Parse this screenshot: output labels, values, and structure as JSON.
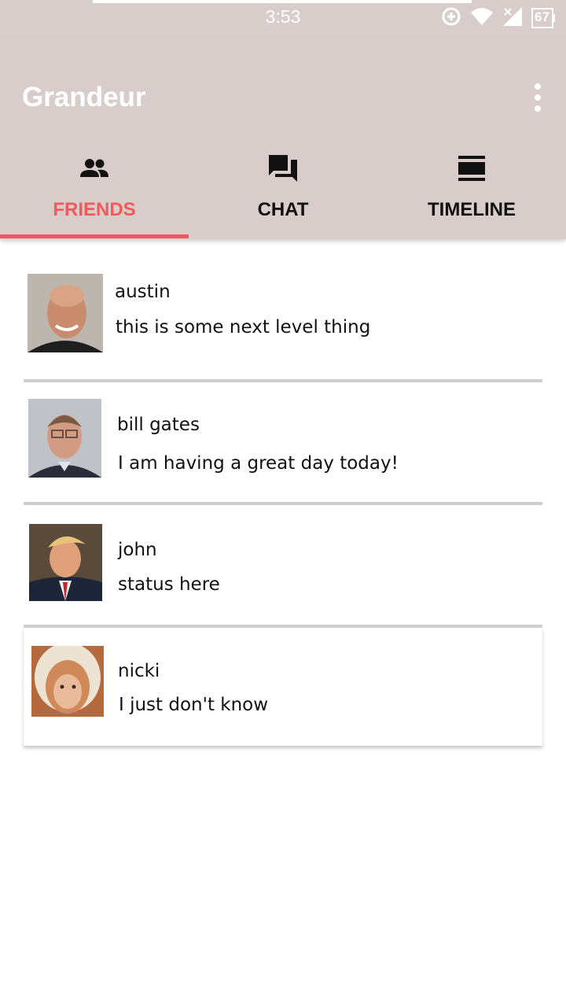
{
  "status_bar": {
    "time": "3:53",
    "battery": "67",
    "icons": [
      "data-saver-icon",
      "wifi-icon",
      "signal-icon",
      "battery-icon"
    ]
  },
  "app_bar": {
    "title": "Grandeur",
    "menu_icon": "overflow-menu-icon"
  },
  "tabs": [
    {
      "label": "FRIENDS",
      "icon": "people-icon",
      "active": true
    },
    {
      "label": "CHAT",
      "icon": "chat-icon",
      "active": false
    },
    {
      "label": "TIMELINE",
      "icon": "timeline-icon",
      "active": false
    }
  ],
  "friends": [
    {
      "name": "austin",
      "status": "this is some next level thing"
    },
    {
      "name": "bill gates",
      "status": "I am having a great day today!"
    },
    {
      "name": "john",
      "status": "status here"
    },
    {
      "name": "nicki",
      "status": "I just don't know"
    }
  ],
  "colors": {
    "appbar": "#d8cdca",
    "accent": "#f05a5a"
  }
}
